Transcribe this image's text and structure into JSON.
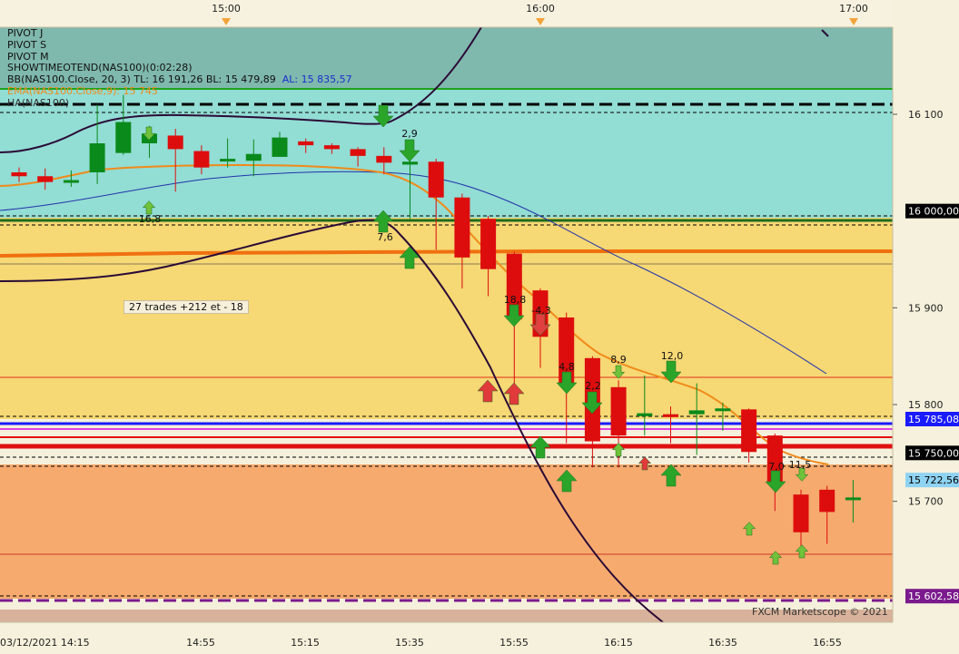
{
  "chart_data": {
    "type": "candlestick",
    "symbol": "NAS100",
    "y_axis": {
      "range": [
        15575,
        16190
      ],
      "ticks": [
        16100,
        15900,
        15800,
        15700
      ],
      "tick_labels": [
        "16 100",
        "15 900",
        "15 800",
        "15 700"
      ]
    },
    "x_axis": {
      "bottom_labels": [
        "03/12/2021 14:15",
        "14:55",
        "15:15",
        "15:35",
        "15:55",
        "16:15",
        "16:35",
        "16:55"
      ],
      "top_labels": [
        "15:00",
        "16:00",
        "17:00"
      ]
    },
    "candles": [
      {
        "o": 16040,
        "h": 16045,
        "l": 16030,
        "c": 16036
      },
      {
        "o": 16036,
        "h": 16044,
        "l": 16022,
        "c": 16030
      },
      {
        "o": 16032,
        "h": 16042,
        "l": 16025,
        "c": 16032
      },
      {
        "o": 16040,
        "h": 16110,
        "l": 16028,
        "c": 16070
      },
      {
        "o": 16060,
        "h": 16120,
        "l": 16058,
        "c": 16092
      },
      {
        "o": 16070,
        "h": 16088,
        "l": 16055,
        "c": 16080
      },
      {
        "o": 16078,
        "h": 16085,
        "l": 16020,
        "c": 16064
      },
      {
        "o": 16062,
        "h": 16068,
        "l": 16038,
        "c": 16045
      },
      {
        "o": 16052,
        "h": 16075,
        "l": 16045,
        "c": 16054
      },
      {
        "o": 16052,
        "h": 16074,
        "l": 16036,
        "c": 16059
      },
      {
        "o": 16056,
        "h": 16082,
        "l": 16056,
        "c": 16076
      },
      {
        "o": 16072,
        "h": 16075,
        "l": 16060,
        "c": 16068
      },
      {
        "o": 16068,
        "h": 16070,
        "l": 16059,
        "c": 16064
      },
      {
        "o": 16064,
        "h": 16066,
        "l": 16046,
        "c": 16057
      },
      {
        "o": 16057,
        "h": 16066,
        "l": 16038,
        "c": 16050
      },
      {
        "o": 16048,
        "h": 16052,
        "l": 15992,
        "c": 16051
      },
      {
        "o": 16051,
        "h": 16054,
        "l": 15960,
        "c": 16014
      },
      {
        "o": 16014,
        "h": 16018,
        "l": 15920,
        "c": 15952
      },
      {
        "o": 15992,
        "h": 15995,
        "l": 15912,
        "c": 15940
      },
      {
        "o": 15956,
        "h": 15958,
        "l": 15820,
        "c": 15888
      },
      {
        "o": 15918,
        "h": 15920,
        "l": 15838,
        "c": 15870
      },
      {
        "o": 15890,
        "h": 15895,
        "l": 15760,
        "c": 15822
      },
      {
        "o": 15848,
        "h": 15850,
        "l": 15735,
        "c": 15762
      },
      {
        "o": 15818,
        "h": 15825,
        "l": 15735,
        "c": 15768
      },
      {
        "o": 15788,
        "h": 15830,
        "l": 15768,
        "c": 15791
      },
      {
        "o": 15790,
        "h": 15798,
        "l": 15760,
        "c": 15787
      },
      {
        "o": 15790,
        "h": 15822,
        "l": 15748,
        "c": 15794
      },
      {
        "o": 15794,
        "h": 15802,
        "l": 15773,
        "c": 15796
      },
      {
        "o": 15795,
        "h": 15796,
        "l": 15740,
        "c": 15751
      },
      {
        "o": 15768,
        "h": 15770,
        "l": 15690,
        "c": 15720
      },
      {
        "o": 15707,
        "h": 15712,
        "l": 15650,
        "c": 15668
      },
      {
        "o": 15712,
        "h": 15716,
        "l": 15656,
        "c": 15689
      },
      {
        "o": 15704,
        "h": 15722,
        "l": 15678,
        "c": 15704
      }
    ],
    "signal_labels": [
      "2,9",
      "7,6",
      "16,8",
      "18,8",
      "-4,3",
      "4,8",
      "2,2",
      "8,9",
      "12,0",
      "7,0",
      "11,5"
    ],
    "price_level_tags": [
      {
        "label": "16 000,00",
        "value": 16000,
        "bg": "#000000",
        "fg": "#ffffff"
      },
      {
        "label": "15 785,08",
        "value": 15785,
        "bg": "#1a1aff",
        "fg": "#ffffff"
      },
      {
        "label": "15 750,00",
        "value": 15750,
        "bg": "#000000",
        "fg": "#ffffff"
      },
      {
        "label": "15 722,56",
        "value": 15722,
        "bg": "#8fd3f3",
        "fg": "#000000"
      },
      {
        "label": "15 602,58",
        "value": 15602,
        "bg": "#7a1a8c",
        "fg": "#ffffff"
      }
    ],
    "bollinger": {
      "TL": "16 191,26",
      "BL": "15 479,89",
      "AL": "15 835,57"
    }
  },
  "legend": {
    "pivot_j": "PIVOT J",
    "pivot_s": "PIVOT S",
    "pivot_m": "PIVOT M",
    "showtime": "SHOWTIMEOTEND(NAS100)(0:02:28)",
    "bb_prefix": "BB(NAS100.Close, 20, 3)  TL: 16 191,26  BL: 15 479,89",
    "bb_al": "AL: 15 835,57",
    "ema": "EMA(NAS100.Close,9): 15 745",
    "ha": "HA(NAS100)"
  },
  "annotation": "27 trades +212 et - 18",
  "copyright": "FXCM Marketscope © 2021",
  "colors": {
    "zone_top": "#7fb8ad",
    "zone_cyan": "#92ddd4",
    "zone_yellow": "#f6d874",
    "zone_orange": "#f6aa6e",
    "bull": "#0a8a1a",
    "bear": "#dd0d0d",
    "ema": "#f08a1a",
    "bb_mid": "#2233aa",
    "bb_band": "#2a0a36"
  }
}
